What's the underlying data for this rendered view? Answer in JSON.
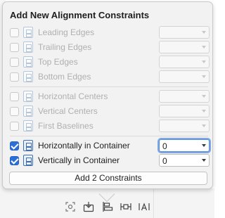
{
  "popover": {
    "title": "Add New Alignment Constraints",
    "groups": [
      [
        {
          "label": "Leading Edges",
          "checked": false,
          "value": ""
        },
        {
          "label": "Trailing Edges",
          "checked": false,
          "value": ""
        },
        {
          "label": "Top Edges",
          "checked": false,
          "value": ""
        },
        {
          "label": "Bottom Edges",
          "checked": false,
          "value": ""
        }
      ],
      [
        {
          "label": "Horizontal Centers",
          "checked": false,
          "value": ""
        },
        {
          "label": "Vertical Centers",
          "checked": false,
          "value": ""
        },
        {
          "label": "First Baselines",
          "checked": false,
          "value": ""
        }
      ],
      [
        {
          "label": "Horizontally in Container",
          "checked": true,
          "value": "0"
        },
        {
          "label": "Vertically in Container",
          "checked": true,
          "value": "0"
        }
      ]
    ],
    "add_button_label": "Add 2 Constraints"
  },
  "toolbar": {
    "icons": [
      "update-frames-icon",
      "embed-in-icon",
      "align-icon",
      "add-constraints-icon",
      "resolve-issues-icon"
    ]
  },
  "colors": {
    "accent": "#2b6fd8",
    "popover_bg": "#f2f2f2",
    "disabled_text": "#b0b0b0"
  }
}
